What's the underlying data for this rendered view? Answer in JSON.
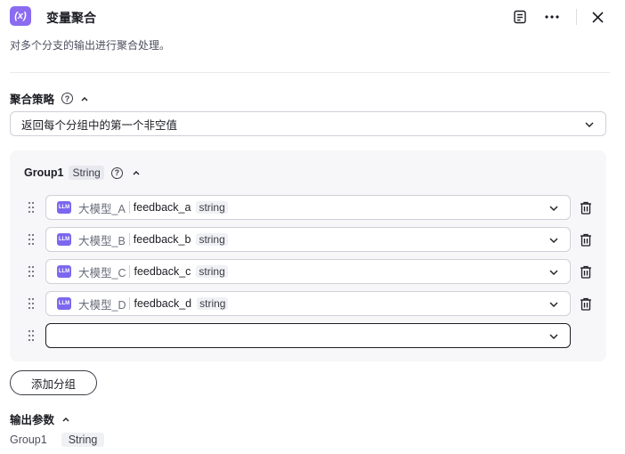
{
  "header": {
    "icon_text": "(x)",
    "title": "变量聚合",
    "icons": [
      "notes-icon",
      "more-icon",
      "close-icon"
    ]
  },
  "description": "对多个分支的输出进行聚合处理。",
  "strategy": {
    "label": "聚合策略",
    "selected": "返回每个分组中的第一个非空值"
  },
  "group": {
    "name": "Group1",
    "type": "String",
    "rows": [
      {
        "badge": "LLM",
        "node": "大模型_A",
        "var": "feedback_a",
        "type": "string"
      },
      {
        "badge": "LLM",
        "node": "大模型_B",
        "var": "feedback_b",
        "type": "string"
      },
      {
        "badge": "LLM",
        "node": "大模型_C",
        "var": "feedback_c",
        "type": "string"
      },
      {
        "badge": "LLM",
        "node": "大模型_D",
        "var": "feedback_d",
        "type": "string"
      }
    ],
    "empty_row_value": ""
  },
  "add_group_label": "添加分组",
  "output": {
    "label": "输出参数",
    "name": "Group1",
    "type": "String"
  },
  "colors": {
    "accent": "#8b6cf0",
    "llm_badge": "#7b68ee",
    "card_bg": "#f7f7f9"
  }
}
